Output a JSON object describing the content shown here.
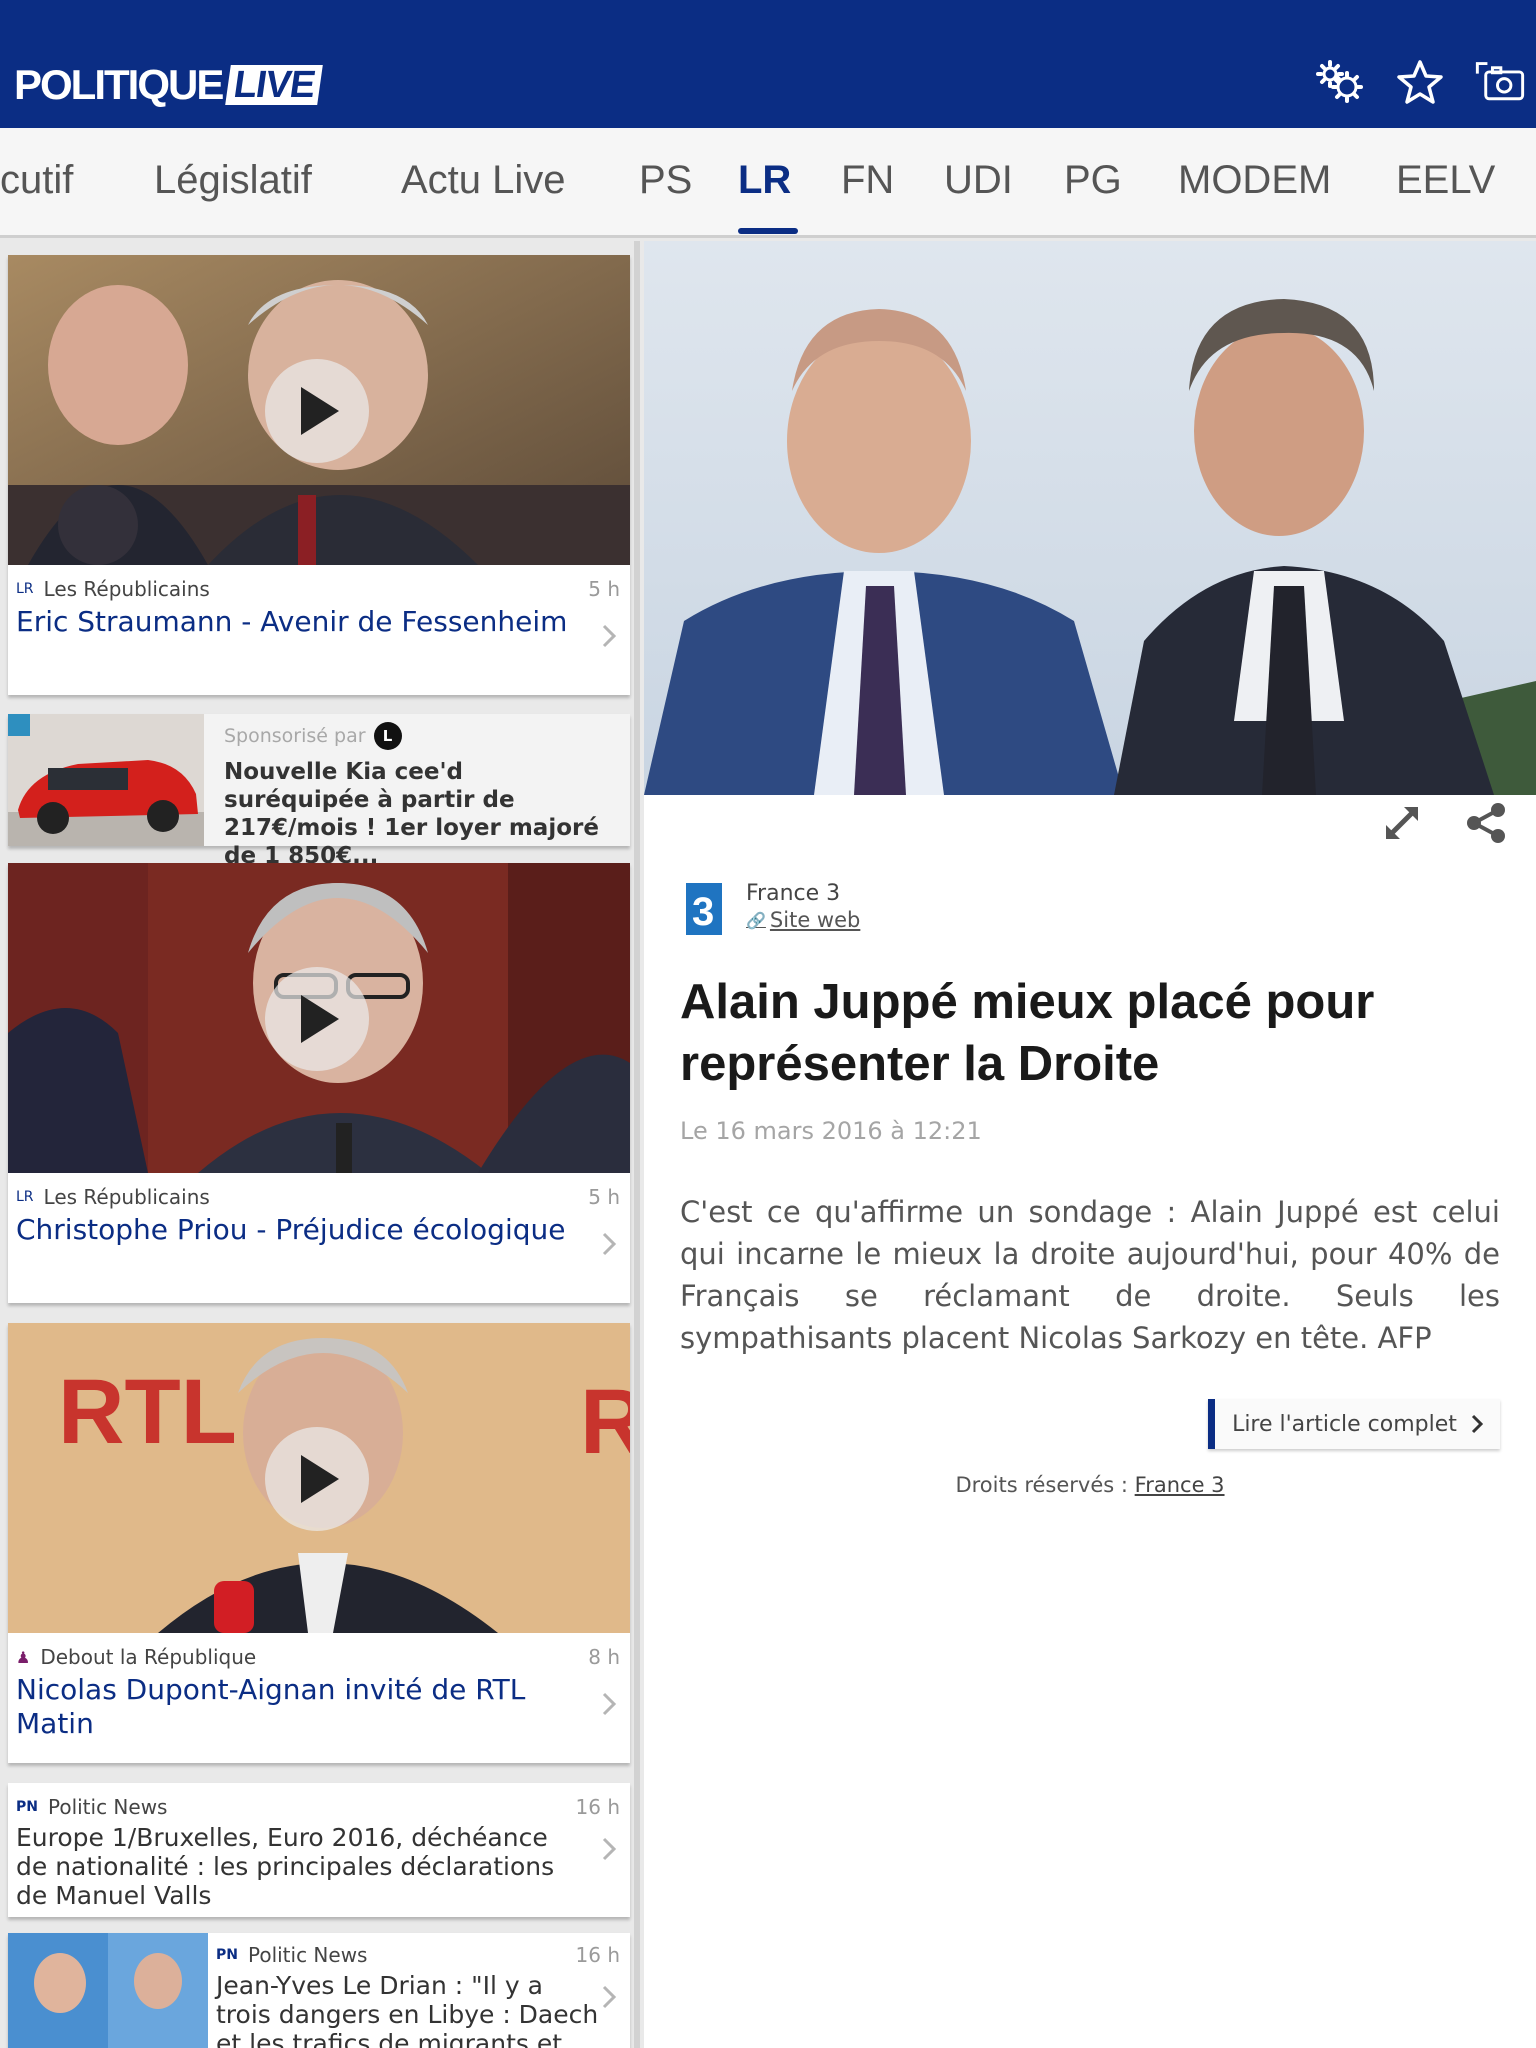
{
  "header": {
    "logo_main": "POLITIQUE",
    "logo_live": "LIVE",
    "icons": [
      "settings-icon",
      "favorite-star-icon",
      "screenshot-icon"
    ]
  },
  "tabs": [
    {
      "label": "cutif",
      "active": false
    },
    {
      "label": "Législatif",
      "active": false
    },
    {
      "label": "Actu Live",
      "active": false
    },
    {
      "label": "PS",
      "active": false
    },
    {
      "label": "LR",
      "active": true
    },
    {
      "label": "FN",
      "active": false
    },
    {
      "label": "UDI",
      "active": false
    },
    {
      "label": "PG",
      "active": false
    },
    {
      "label": "MODEM",
      "active": false
    },
    {
      "label": "EELV",
      "active": false
    }
  ],
  "feed": {
    "cards": [
      {
        "source": "Les Républicains",
        "age": "5 h",
        "title": "Eric Straumann - Avenir de Fessenheim"
      },
      {
        "sponsor_label": "Sponsorisé par",
        "sponsor_badge": "L",
        "title": "Nouvelle Kia cee'd suréquipée à partir de 217€/mois ! 1er loyer majoré de 1 850€..."
      },
      {
        "source": "Les Républicains",
        "age": "5 h",
        "title": "Christophe Priou - Préjudice écologique"
      },
      {
        "source": "Debout la République",
        "age": "8 h",
        "title": "Nicolas Dupont-Aignan invité de RTL Matin"
      },
      {
        "source": "Politic News",
        "age": "16 h",
        "title": "Europe 1/Bruxelles, Euro 2016, déchéance de nationalité : les principales déclarations de Manuel Valls"
      },
      {
        "source": "Politic News",
        "age": "16 h",
        "title": "Jean-Yves Le Drian : \"Il y a trois dangers en Libye : Daech et les trafics de migrants et d'armes\""
      }
    ]
  },
  "article": {
    "source_name": "France 3",
    "source_link": "Site web",
    "headline": "Alain Juppé mieux placé pour représenter la Droite",
    "date": "Le 16 mars 2016 à 12:21",
    "body": "C'est ce qu'affirme un sondage : Alain Juppé est celui qui incarne le mieux la droite aujourd'hui, pour 40% de Français se réclamant de droite. Seuls les sympathisants placent Nicolas Sarkozy en tête. AFP",
    "read_more": "Lire l'article complet",
    "rights_label": "Droits réservés :",
    "rights_source": "France 3"
  },
  "colors": {
    "brand": "#0b2d84",
    "background": "#e9e9e9"
  }
}
